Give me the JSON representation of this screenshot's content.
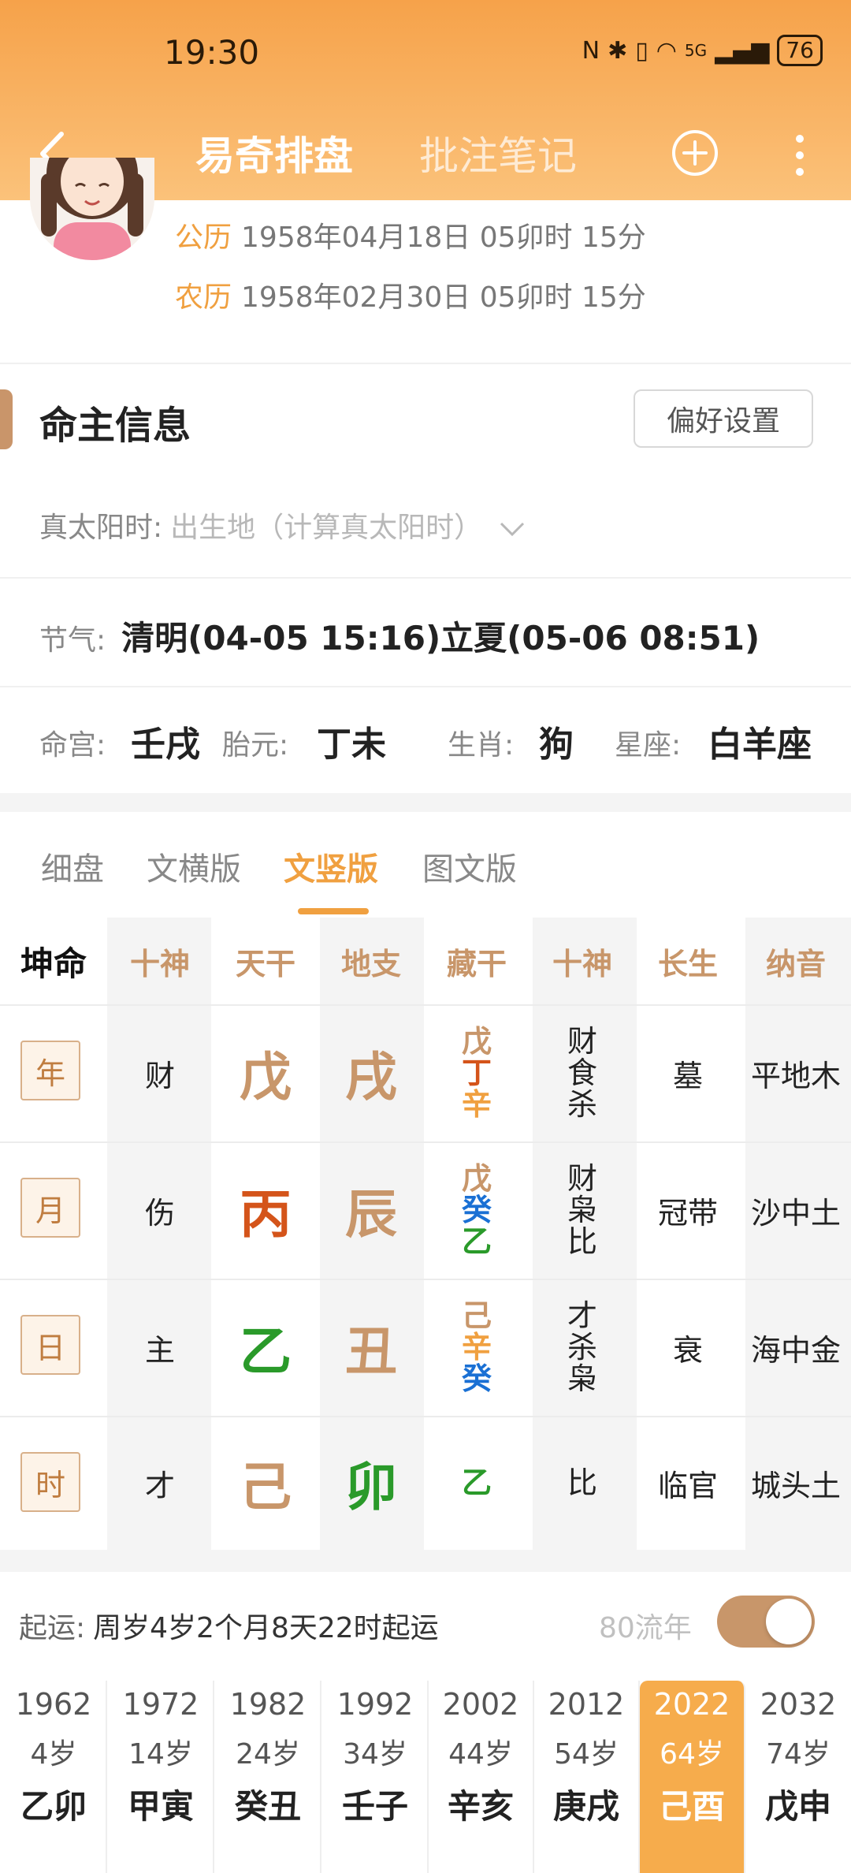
{
  "status": {
    "time": "19:30",
    "network": "5G",
    "battery": "76"
  },
  "nav": {
    "title_active": "易奇排盘",
    "title_inactive": "批注笔记"
  },
  "profile": {
    "solar_label": "公历",
    "solar_value": "1958年04月18日 05卯时 15分",
    "lunar_label": "农历",
    "lunar_value": "1958年02月30日 05卯时 15分"
  },
  "section": {
    "title": "命主信息",
    "pref_button": "偏好设置"
  },
  "solar_time": {
    "label": "真太阳时:",
    "value": "出生地（计算真太阳时）"
  },
  "jieqi": {
    "label": "节气:",
    "value": "清明(04-05 15:16)立夏(05-06 08:51)"
  },
  "info": {
    "minggong_label": "命宫:",
    "minggong_value": "壬戌",
    "taiyuan_label": "胎元:",
    "taiyuan_value": "丁未",
    "shengxiao_label": "生肖:",
    "shengxiao_value": "狗",
    "xingzuo_label": "星座:",
    "xingzuo_value": "白羊座"
  },
  "view_tabs": [
    "细盘",
    "文横版",
    "文竖版",
    "图文版"
  ],
  "view_tab_active": "文竖版",
  "grid": {
    "kun": "坤命",
    "headers": [
      "十神",
      "天干",
      "地支",
      "藏干",
      "十神",
      "长生",
      "纳音"
    ],
    "rows": [
      {
        "pillar": "年",
        "shishen": "财",
        "tiangan": "戊",
        "dizhi": "戌",
        "canggan": [
          "戊",
          "丁",
          "辛"
        ],
        "shishen2": [
          "财",
          "食",
          "杀"
        ],
        "changsheng": "墓",
        "nayin": "平地木"
      },
      {
        "pillar": "月",
        "shishen": "伤",
        "tiangan": "丙",
        "dizhi": "辰",
        "canggan": [
          "戊",
          "癸",
          "乙"
        ],
        "shishen2": [
          "财",
          "枭",
          "比"
        ],
        "changsheng": "冠带",
        "nayin": "沙中土"
      },
      {
        "pillar": "日",
        "shishen": "主",
        "tiangan": "乙",
        "dizhi": "丑",
        "canggan": [
          "己",
          "辛",
          "癸"
        ],
        "shishen2": [
          "才",
          "杀",
          "枭"
        ],
        "changsheng": "衰",
        "nayin": "海中金"
      },
      {
        "pillar": "时",
        "shishen": "才",
        "tiangan": "己",
        "dizhi": "卯",
        "canggan": [
          "乙"
        ],
        "shishen2": [
          "比"
        ],
        "changsheng": "临官",
        "nayin": "城头土"
      }
    ]
  },
  "colors": {
    "earth": "#c8966a",
    "fire": "#d4541a",
    "wood": "#2a9a2a",
    "water": "#1a70d4",
    "metal": "#f0a040",
    "accent": "#f0a040"
  },
  "qiyun": {
    "label": "起运:",
    "value": "周岁4岁2个月8天22时起运",
    "liunian": "80流年"
  },
  "luck": [
    {
      "year": "1962",
      "age": "4岁",
      "gz": "乙卯"
    },
    {
      "year": "1972",
      "age": "14岁",
      "gz": "甲寅"
    },
    {
      "year": "1982",
      "age": "24岁",
      "gz": "癸丑"
    },
    {
      "year": "1992",
      "age": "34岁",
      "gz": "壬子"
    },
    {
      "year": "2002",
      "age": "44岁",
      "gz": "辛亥"
    },
    {
      "year": "2012",
      "age": "54岁",
      "gz": "庚戌"
    },
    {
      "year": "2022",
      "age": "64岁",
      "gz": "己酉",
      "current": true
    },
    {
      "year": "2032",
      "age": "74岁",
      "gz": "戊申"
    }
  ]
}
